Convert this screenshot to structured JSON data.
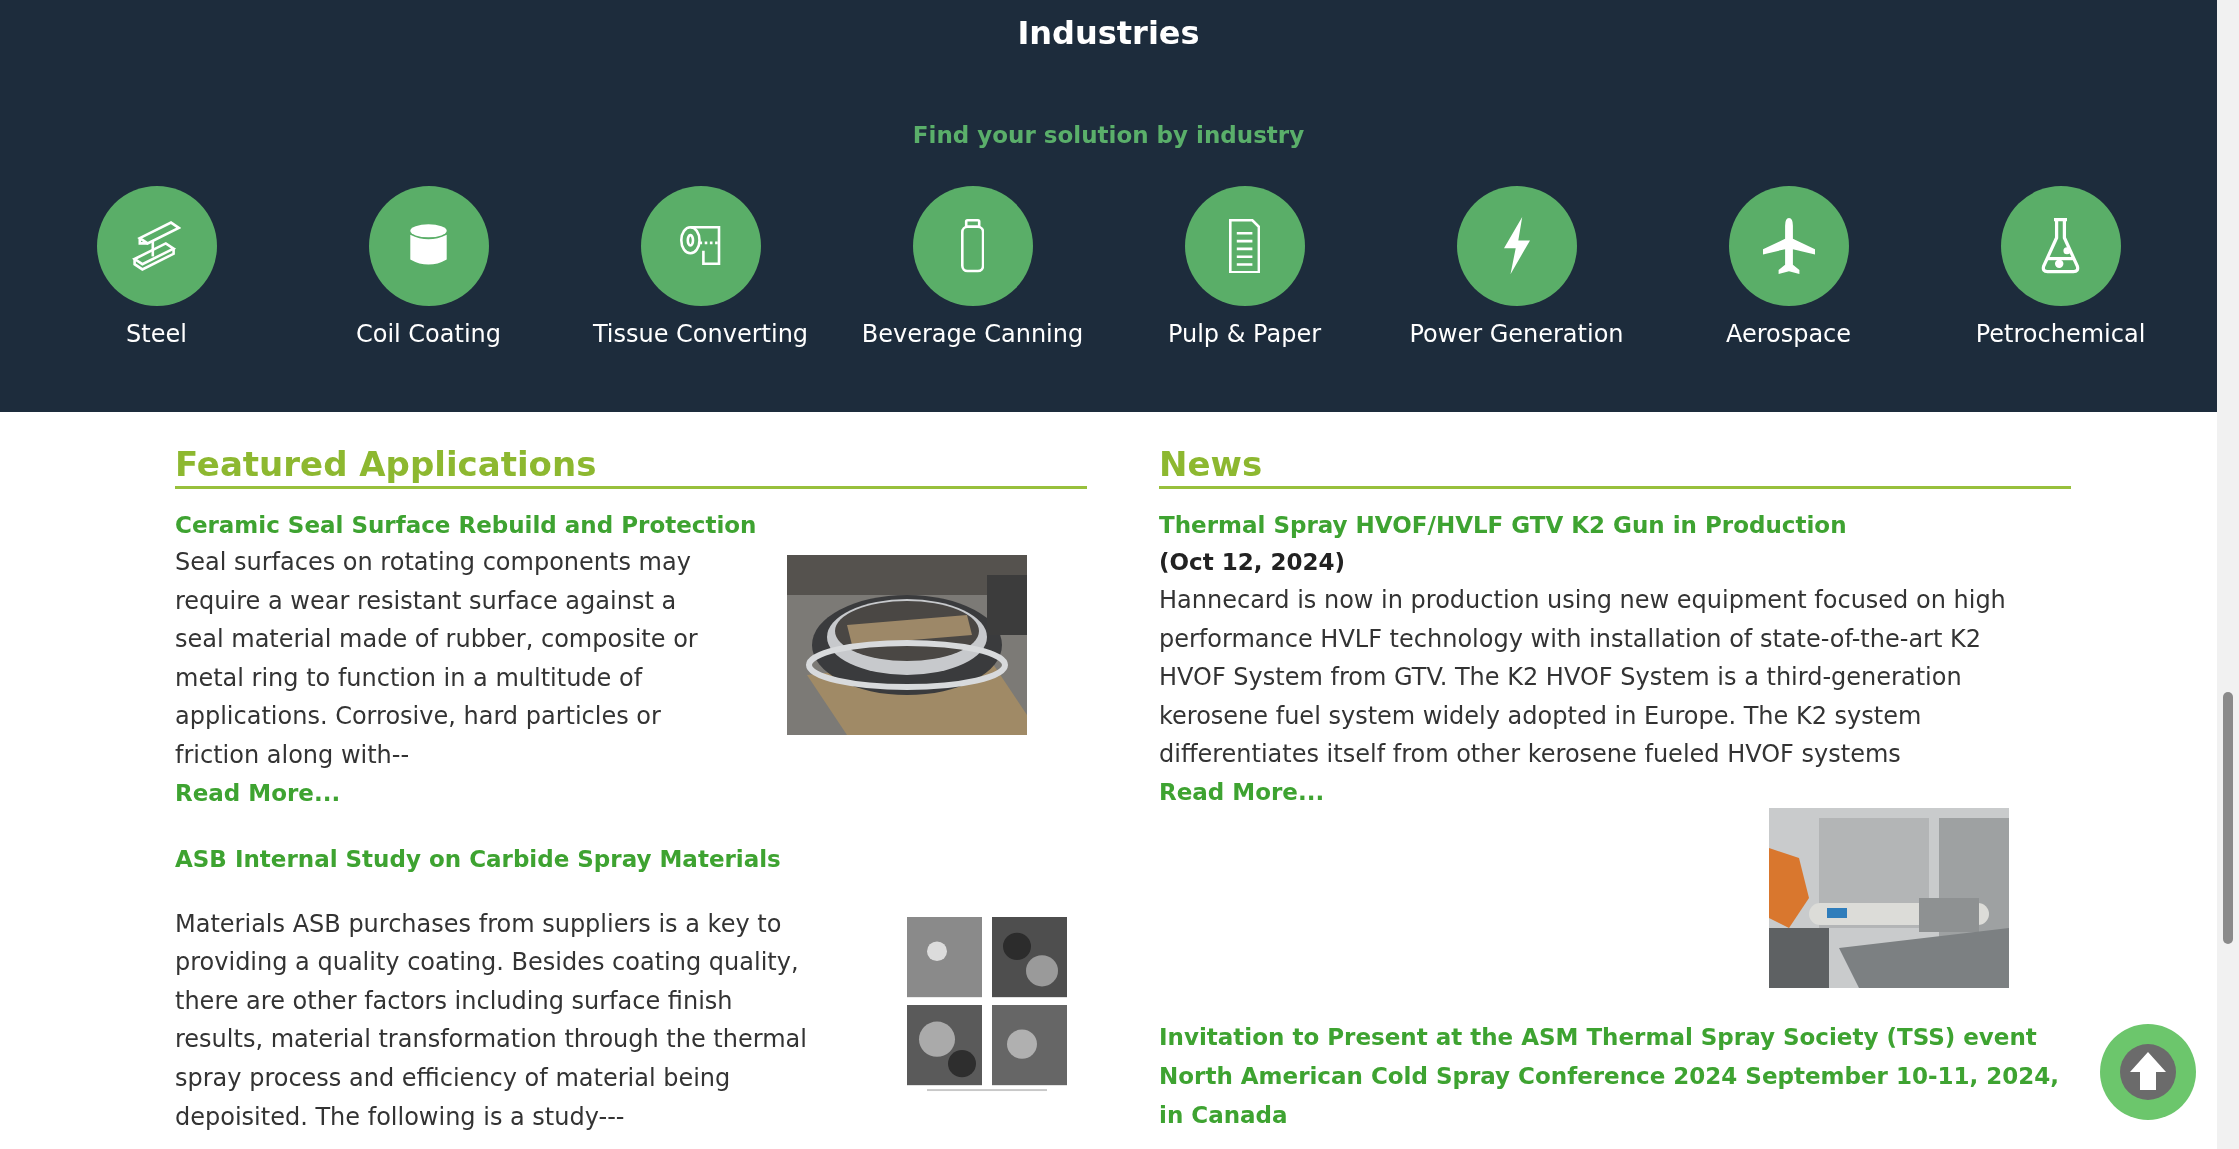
{
  "industries": {
    "title": "Industries",
    "subtitle": "Find your solution by industry",
    "items": [
      {
        "label": "Steel"
      },
      {
        "label": "Coil Coating"
      },
      {
        "label": "Tissue Converting"
      },
      {
        "label": "Beverage Canning"
      },
      {
        "label": "Pulp & Paper"
      },
      {
        "label": "Power Generation"
      },
      {
        "label": "Aerospace"
      },
      {
        "label": "Petrochemical"
      }
    ]
  },
  "featured": {
    "heading": "Featured Applications",
    "articles": [
      {
        "title": "Ceramic Seal Surface Rebuild and Protection",
        "body": "Seal surfaces on rotating components may require a wear resistant surface against a seal material made of rubber, composite or metal ring to function in a multitude of applications. Corrosive, hard particles or friction along with--",
        "read_more": "Read More..."
      },
      {
        "title": "ASB Internal Study on Carbide Spray Materials",
        "body": "Materials  ASB purchases from suppliers is a key to providing a quality coating. Besides coating quality, there are other factors including surface finish results, material transformation through the thermal spray process and efficiency of material being depoisited.  The following is a study---"
      }
    ]
  },
  "news": {
    "heading": "News",
    "articles": [
      {
        "title": "Thermal Spray HVOF/HVLF GTV K2 Gun in Production",
        "date": "(Oct 12, 2024)",
        "body": "Hannecard is now in production using new equipment focused on high performance HVLF technology with installation of state-of-the-art K2 HVOF System from GTV. The K2 HVOF System is a third-generation kerosene fuel system widely adopted in Europe. The K2 system differentiates itself from other kerosene fueled HVOF systems",
        "read_more": "Read More..."
      },
      {
        "title": "Invitation to Present at the ASM Thermal Spray Society (TSS) event North American Cold Spray Conference 2024 September 10-11, 2024, in Canada"
      }
    ]
  }
}
